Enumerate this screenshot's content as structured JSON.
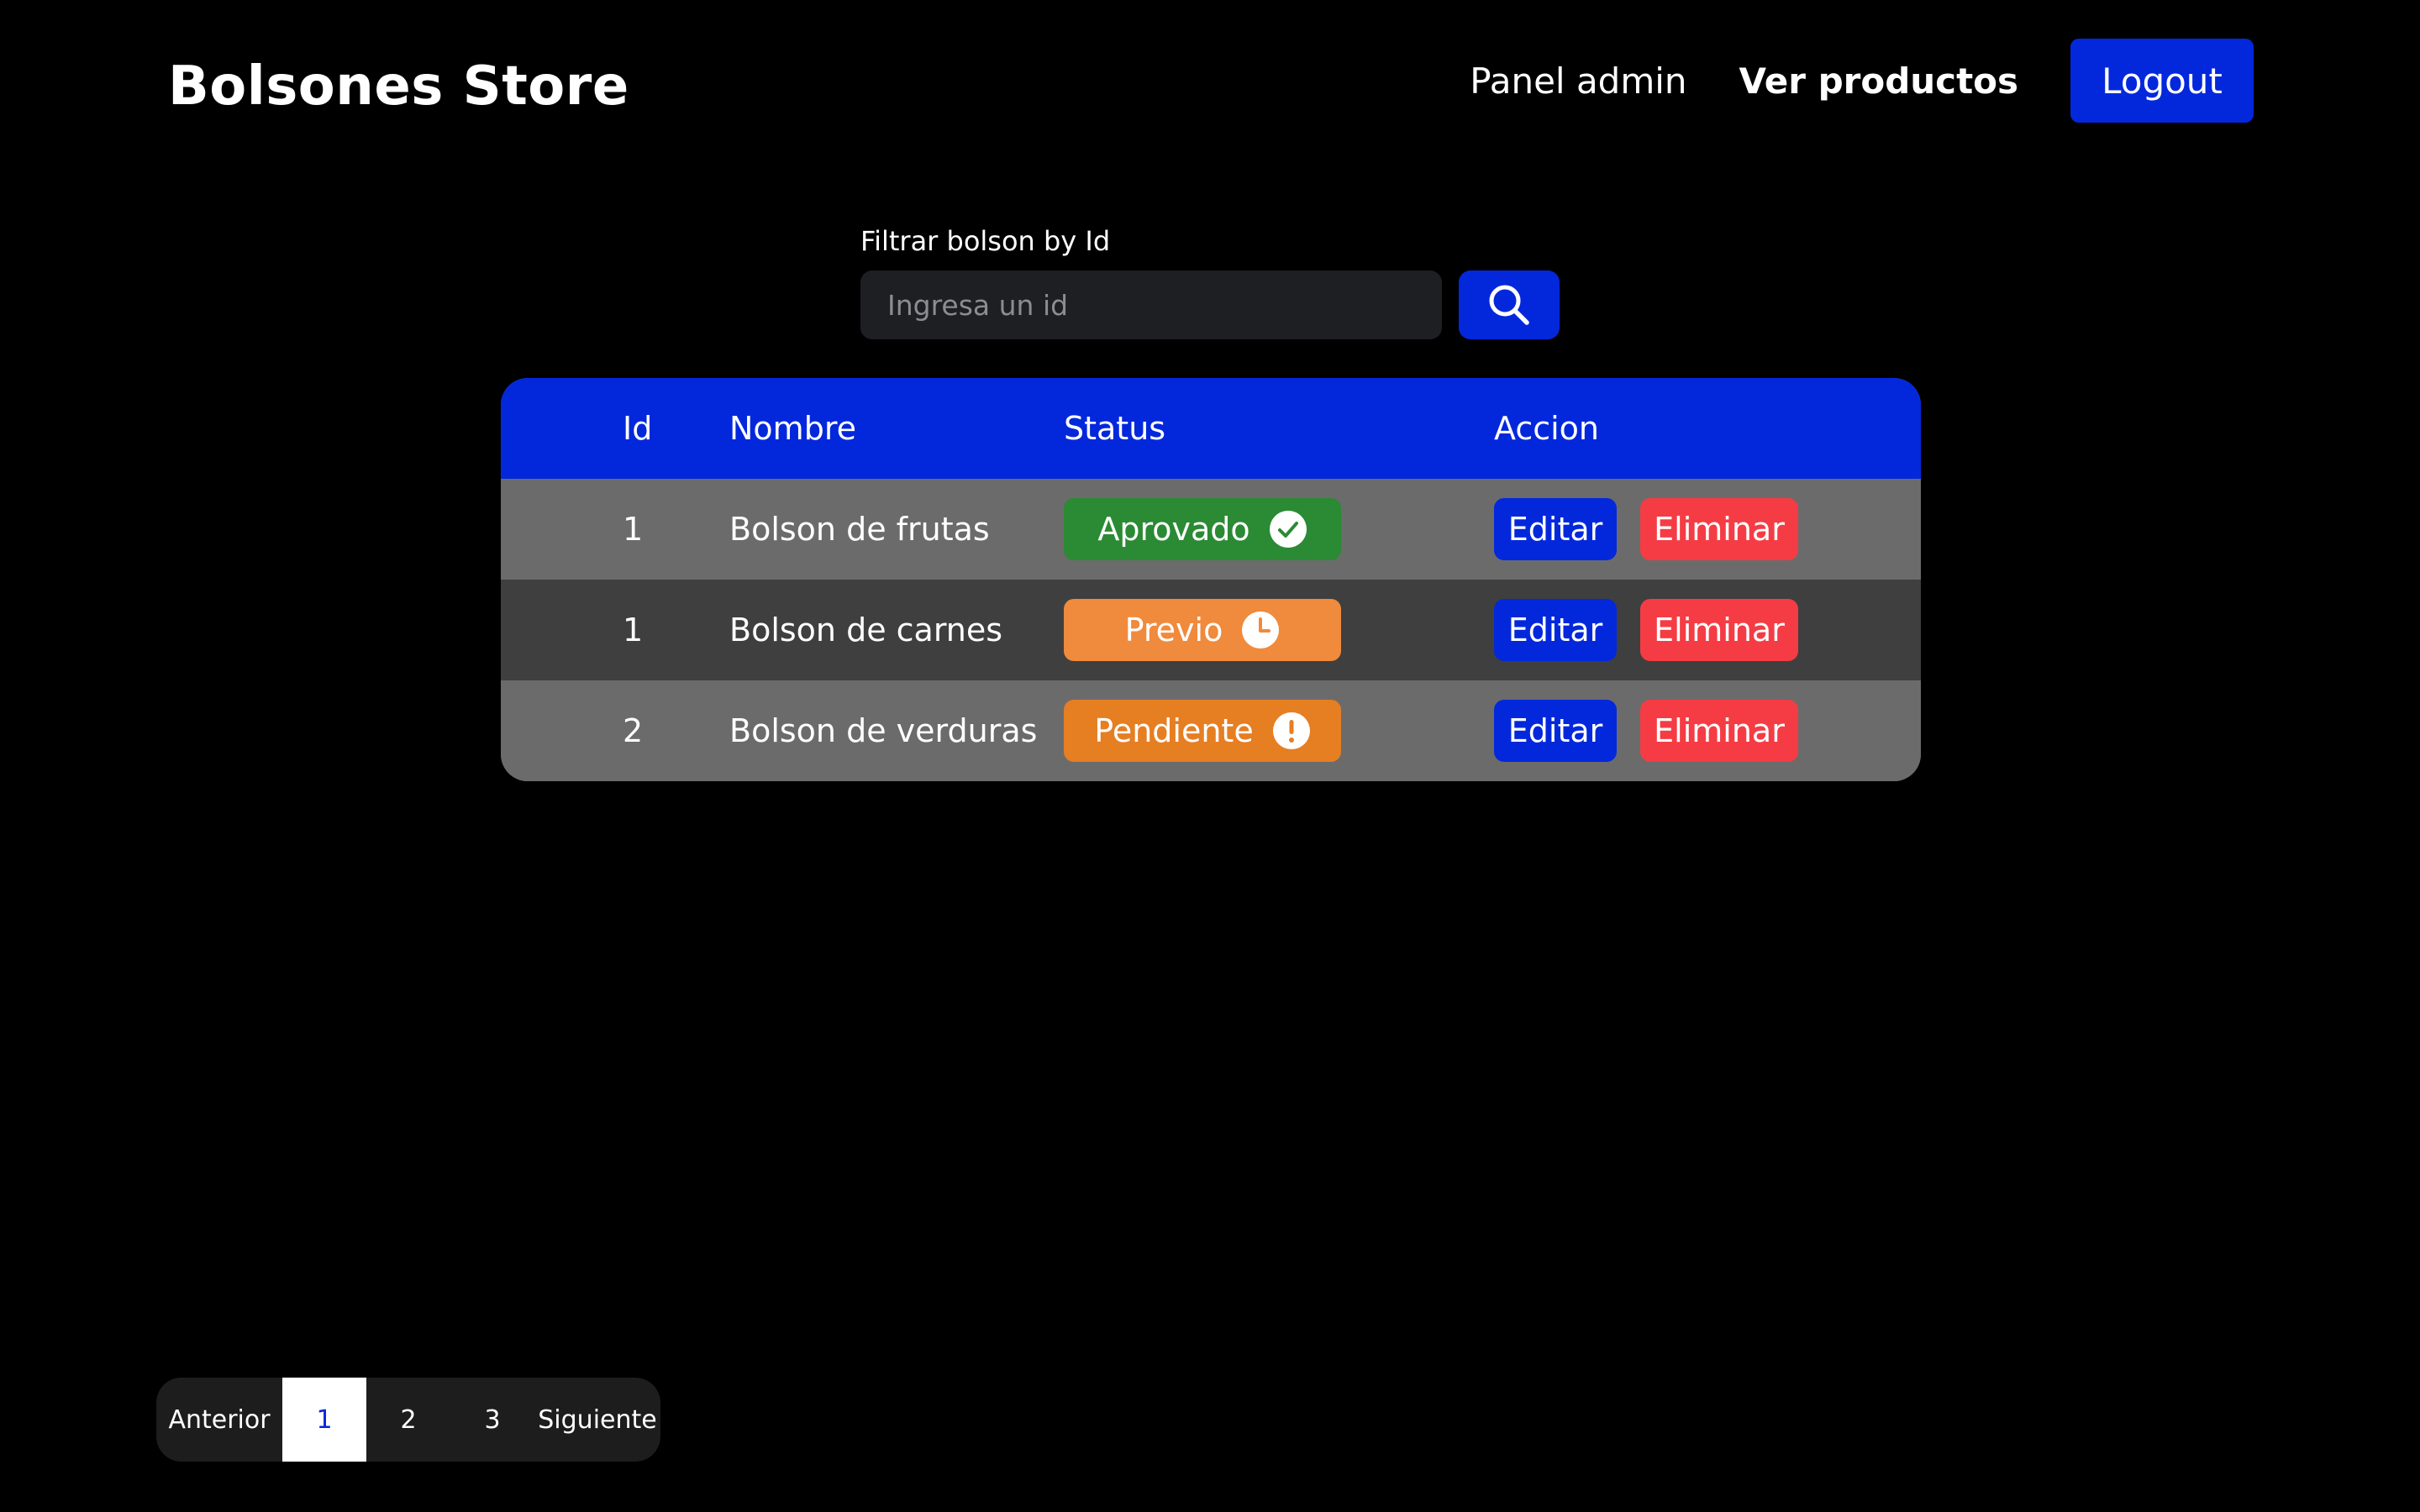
{
  "brand": "Bolsones Store",
  "nav": {
    "panel_admin": "Panel admin",
    "ver_productos": "Ver productos",
    "logout": "Logout"
  },
  "filter": {
    "label": "Filtrar bolson by Id",
    "placeholder": "Ingresa un id",
    "value": ""
  },
  "table": {
    "headers": {
      "id": "Id",
      "nombre": "Nombre",
      "status": "Status",
      "accion": "Accion"
    },
    "rows": [
      {
        "id": "1",
        "nombre": "Bolson de frutas",
        "status": "Aprovado",
        "status_icon": "check-circle-icon",
        "status_color": "#2b8a34",
        "edit": "Editar",
        "delete": "Eliminar"
      },
      {
        "id": "1",
        "nombre": "Bolson de carnes",
        "status": "Previo",
        "status_icon": "clock-icon",
        "status_color": "#f08a3c",
        "edit": "Editar",
        "delete": "Eliminar"
      },
      {
        "id": "2",
        "nombre": "Bolson de verduras",
        "status": "Pendiente",
        "status_icon": "alert-circle-icon",
        "status_color": "#e67e22",
        "edit": "Editar",
        "delete": "Eliminar"
      }
    ]
  },
  "pagination": {
    "prev": "Anterior",
    "pages": [
      "1",
      "2",
      "3"
    ],
    "active": "1",
    "next": "Siguiente"
  },
  "colors": {
    "accent": "#0328dc",
    "danger": "#f53c44",
    "background": "#000000"
  }
}
